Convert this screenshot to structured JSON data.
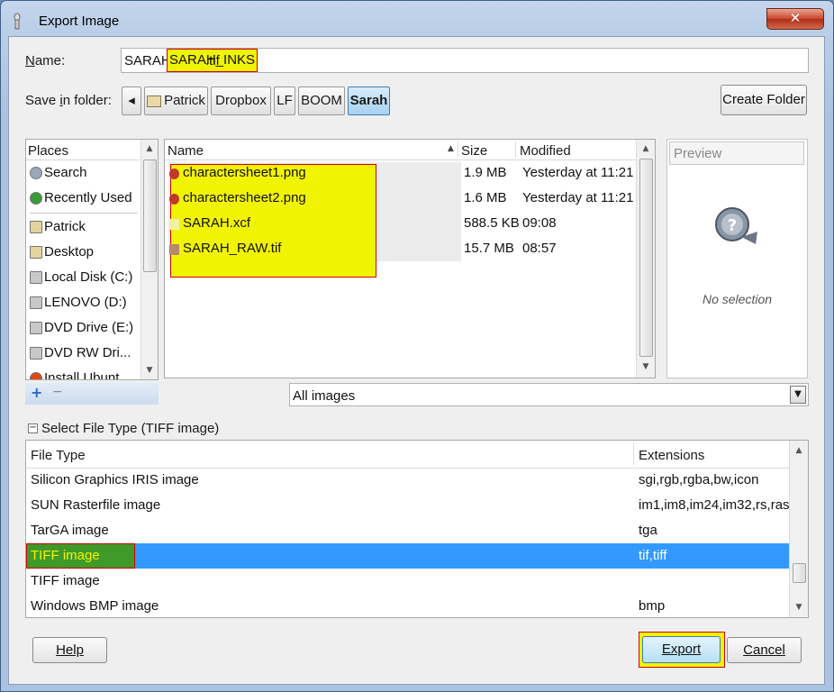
{
  "window": {
    "title": "Export Image",
    "close_glyph": "✕"
  },
  "name_row": {
    "label": "Name:",
    "filename_highlight": "SARAH_INKS",
    "filename_ext": ".tif"
  },
  "folder_row": {
    "label": "Save in folder:",
    "crumbs": [
      "Patrick",
      "Dropbox",
      "LF",
      "BOOM",
      "Sarah"
    ],
    "create_folder": "Create Folder"
  },
  "places": {
    "header": "Places",
    "items": [
      "Search",
      "Recently Used",
      "Patrick",
      "Desktop",
      "Local Disk (C:)",
      "LENOVO (D:)",
      "DVD Drive (E:)",
      "DVD RW Dri...",
      "Install Ubunt"
    ],
    "add_glyph": "+",
    "remove_glyph": "−"
  },
  "files": {
    "columns": {
      "name": "Name",
      "size": "Size",
      "modified": "Modified"
    },
    "rows": [
      {
        "name": "charactersheet1.png",
        "size": "1.9 MB",
        "modified": "Yesterday at 11:21",
        "icon": "image-file-icon"
      },
      {
        "name": "charactersheet2.png",
        "size": "1.6 MB",
        "modified": "Yesterday at 11:21",
        "icon": "image-file-icon"
      },
      {
        "name": "SARAH.xcf",
        "size": "588.5 KB",
        "modified": "09:08",
        "icon": "gimp-file-icon"
      },
      {
        "name": "SARAH_RAW.tif",
        "size": "15.7 MB",
        "modified": "08:57",
        "icon": "tiff-file-icon"
      }
    ]
  },
  "preview": {
    "header": "Preview",
    "empty_text": "No selection"
  },
  "filter": {
    "selected": "All images"
  },
  "file_type": {
    "toggle_label": "Select File Type (TIFF image)",
    "columns": {
      "type": "File Type",
      "ext": "Extensions"
    },
    "rows": [
      {
        "type": "Silicon Graphics IRIS image",
        "ext": "sgi,rgb,rgba,bw,icon"
      },
      {
        "type": "SUN Rasterfile image",
        "ext": "im1,im8,im24,im32,rs,ras"
      },
      {
        "type": "TarGA image",
        "ext": "tga"
      },
      {
        "type": "TIFF image",
        "ext": "tif,tiff"
      },
      {
        "type": "TIFF image",
        "ext": ""
      },
      {
        "type": "Windows BMP image",
        "ext": "bmp"
      }
    ],
    "selected_index": 3
  },
  "buttons": {
    "help": "Help",
    "export": "Export",
    "cancel": "Cancel"
  },
  "colors": {
    "selection": "#3399ff",
    "highlight": "#f1f400",
    "annotation_border": "#d00000"
  }
}
